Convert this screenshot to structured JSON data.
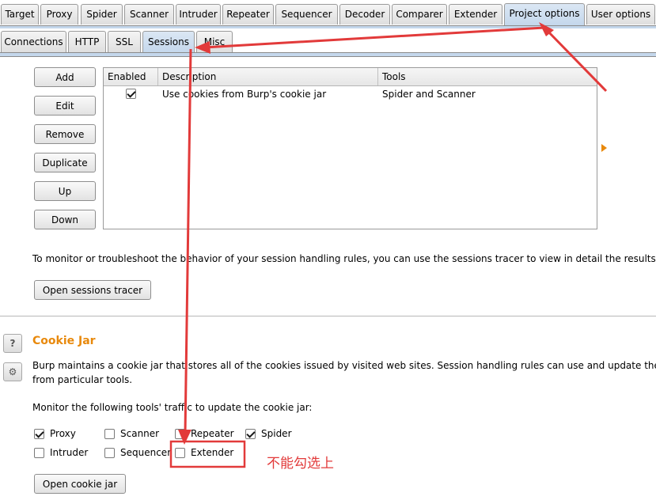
{
  "top_tabs": [
    "Target",
    "Proxy",
    "Spider",
    "Scanner",
    "Intruder",
    "Repeater",
    "Sequencer",
    "Decoder",
    "Comparer",
    "Extender",
    "Project options",
    "User options"
  ],
  "sub_tabs": [
    "Connections",
    "HTTP",
    "SSL",
    "Sessions",
    "Misc"
  ],
  "session_rules": {
    "buttons": {
      "add": "Add",
      "edit": "Edit",
      "remove": "Remove",
      "duplicate": "Duplicate",
      "up": "Up",
      "down": "Down"
    },
    "columns": [
      "Enabled",
      "Description",
      "Tools"
    ],
    "rows": [
      {
        "enabled": true,
        "description": "Use cookies from Burp's cookie jar",
        "tools": "Spider and Scanner"
      }
    ]
  },
  "tracer": {
    "description": "To monitor or troubleshoot the behavior of your session handling rules, you can use the sessions tracer to view in detail the results of pro",
    "button": "Open sessions tracer"
  },
  "cookie_jar": {
    "title": "Cookie Jar",
    "description_line1": "Burp maintains a cookie jar that stores all of the cookies issued by visited web sites. Session handling rules can use and update these c",
    "description_line2": "from particular tools.",
    "monitor_label": "Monitor the following tools' traffic to update the cookie jar:",
    "tools": {
      "proxy": {
        "label": "Proxy",
        "checked": true
      },
      "scanner": {
        "label": "Scanner",
        "checked": false
      },
      "repeater": {
        "label": "Repeater",
        "checked": false
      },
      "spider": {
        "label": "Spider",
        "checked": true
      },
      "intruder": {
        "label": "Intruder",
        "checked": false
      },
      "sequencer": {
        "label": "Sequencer",
        "checked": false
      },
      "extender": {
        "label": "Extender",
        "checked": false
      }
    },
    "open_button": "Open cookie jar"
  },
  "annotation": "不能勾选上",
  "colors": {
    "accent": "#e8890c",
    "annotation": "#e23a3a",
    "active_tab": "#c4d7ec"
  }
}
